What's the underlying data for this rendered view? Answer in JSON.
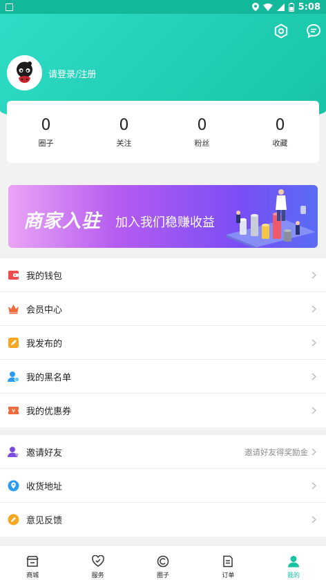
{
  "status_bar": {
    "time": "5:08"
  },
  "profile": {
    "login_text": "请登录/注册"
  },
  "stats": [
    {
      "value": "0",
      "label": "圈子"
    },
    {
      "value": "0",
      "label": "关注"
    },
    {
      "value": "0",
      "label": "粉丝"
    },
    {
      "value": "0",
      "label": "收藏"
    }
  ],
  "banner": {
    "title": "商家入驻",
    "subtitle": "加入我们稳赚收益"
  },
  "menu_group_1": [
    {
      "label": "我的钱包",
      "icon": "wallet-icon"
    },
    {
      "label": "会员中心",
      "icon": "crown-icon"
    },
    {
      "label": "我发布的",
      "icon": "edit-icon"
    },
    {
      "label": "我的黑名单",
      "icon": "user-block-icon"
    },
    {
      "label": "我的优惠券",
      "icon": "coupon-icon"
    }
  ],
  "menu_group_2": [
    {
      "label": "邀请好友",
      "icon": "invite-icon",
      "hint": "邀请好友得奖励金"
    },
    {
      "label": "收货地址",
      "icon": "location-icon"
    },
    {
      "label": "意见反馈",
      "icon": "feedback-icon"
    }
  ],
  "bottom_nav": [
    {
      "label": "商城",
      "icon": "store-icon"
    },
    {
      "label": "服务",
      "icon": "heart-service-icon"
    },
    {
      "label": "圈子",
      "icon": "circle-icon"
    },
    {
      "label": "订单",
      "icon": "order-icon"
    },
    {
      "label": "我的",
      "icon": "profile-icon",
      "active": true
    }
  ],
  "colors": {
    "accent": "#17c3a3",
    "header_start": "#2fdcc7",
    "banner_start": "#e9a4f5",
    "banner_end": "#5a6cf6"
  }
}
